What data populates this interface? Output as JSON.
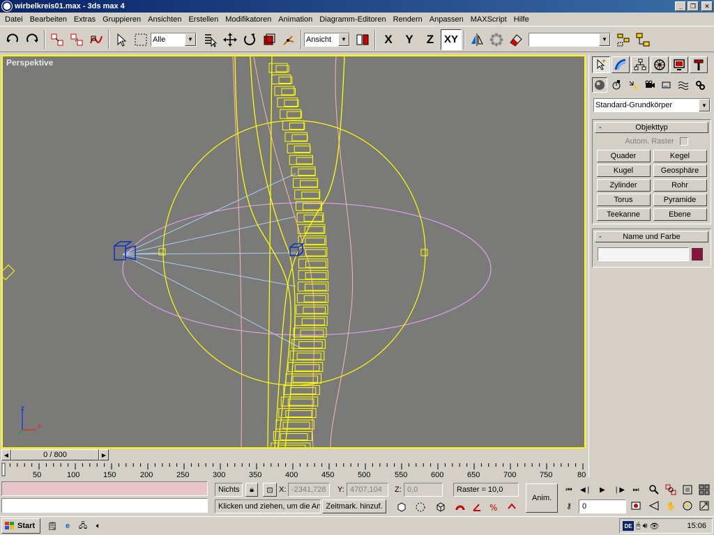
{
  "window": {
    "title": "wirbelkreis01.max - 3ds max 4"
  },
  "menu": [
    "Datei",
    "Bearbeiten",
    "Extras",
    "Gruppieren",
    "Ansichten",
    "Erstellen",
    "Modifikatoren",
    "Animation",
    "Diagramm-Editoren",
    "Rendern",
    "Anpassen",
    "MAXScript",
    "Hilfe"
  ],
  "toolbar": {
    "selection_filter": "Alle",
    "reference_coord": "Ansicht",
    "axis_x": "X",
    "axis_y": "Y",
    "axis_z": "Z",
    "axis_xy": "XY",
    "named_selection": ""
  },
  "viewport": {
    "label": "Perspektive",
    "gizmo_z": "z",
    "gizmo_x": "x"
  },
  "command_panel": {
    "category": "Standard-Grundkörper",
    "rollout_objecttype": "Objekttyp",
    "auto_grid": "Autom. Raster",
    "buttons": [
      "Quader",
      "Kegel",
      "Kugel",
      "Geosphäre",
      "Zylinder",
      "Rohr",
      "Torus",
      "Pyramide",
      "Teekanne",
      "Ebene"
    ],
    "rollout_name_color": "Name und Farbe",
    "object_name": "",
    "object_color": "#8c1040"
  },
  "time_slider": {
    "position": "0 / 800"
  },
  "trackbar": {
    "ticks": [
      "50",
      "100",
      "150",
      "200",
      "250",
      "300",
      "350",
      "400",
      "450",
      "500",
      "550",
      "600",
      "650",
      "700",
      "750",
      "80"
    ]
  },
  "status": {
    "selection": "Nichts",
    "x_label": "X:",
    "x_value": "-2341,728",
    "y_label": "Y:",
    "y_value": "4707,104",
    "z_label": "Z:",
    "z_value": "0,0",
    "grid": "Raster = 10,0",
    "prompt": "Klicken und ziehen, um die An",
    "add_time_tag": "Zeitmark. hinzuf.",
    "anim": "Anim.",
    "frame": "0"
  },
  "taskbar": {
    "start": "Start",
    "language": "DE",
    "clock": "15:06"
  }
}
